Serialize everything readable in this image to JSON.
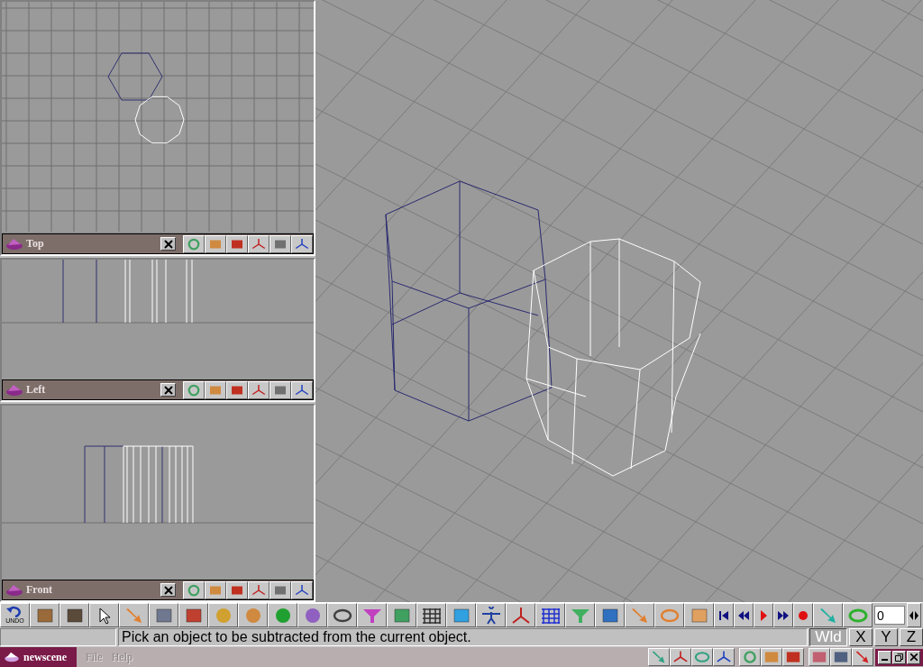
{
  "viewports": [
    {
      "kind": "top",
      "title": "Top"
    },
    {
      "kind": "side",
      "title": "Left"
    },
    {
      "kind": "front",
      "title": "Front"
    }
  ],
  "toolbar": {
    "undo_label": "UNDO",
    "frame_field": "0"
  },
  "status": {
    "message": "Pick an object to be subtracted from the current object.",
    "coords": [
      {
        "label": "Wld",
        "selected": true
      },
      {
        "label": "X",
        "selected": false
      },
      {
        "label": "Y",
        "selected": false
      },
      {
        "label": "Z",
        "selected": false
      }
    ]
  },
  "menubar": {
    "scene": "newscene",
    "menus": [
      {
        "label": "File",
        "disabled": true
      },
      {
        "label": "Help",
        "disabled": true
      }
    ]
  }
}
